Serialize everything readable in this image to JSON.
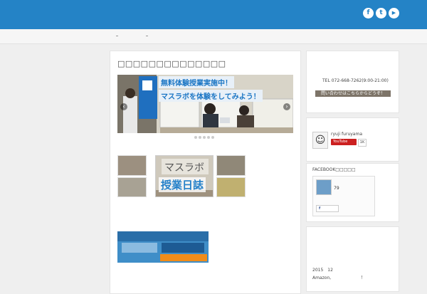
{
  "header": {
    "social": [
      {
        "name": "facebook",
        "icon": "facebook-icon",
        "glyph": "f"
      },
      {
        "name": "twitter",
        "icon": "twitter-icon",
        "glyph": "t"
      },
      {
        "name": "youtube",
        "icon": "youtube-icon",
        "glyph": "▶"
      }
    ],
    "accent_color": "#2483c6"
  },
  "main": {
    "title": "□□□□□□□□□□□□□□",
    "slider": {
      "line1": "無料体験授業実施中！",
      "line2": "マスラボを体験をしてみよう！",
      "prev": "‹",
      "next": "›"
    },
    "diary_label": "授業日誌"
  },
  "sidebar": {
    "tel": "TEL 072-668-7262(9:00-21:00)",
    "contact_button": "問い合わせはこちらからどうぞ！",
    "youtube": {
      "name": "ryuji furuyama",
      "button": "YouTube",
      "count": "1K"
    },
    "facebook": {
      "title": "FACEBOOK□□□□□",
      "count": "79",
      "like": "f"
    },
    "news": {
      "date": "2015　12",
      "text": "Amazon,　　　　　　　！"
    }
  }
}
